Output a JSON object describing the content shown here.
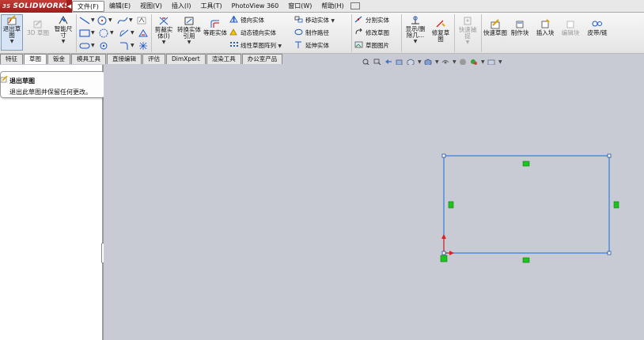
{
  "app": {
    "logo_text": "SOLIDWORKS",
    "logo_prefix": "3S"
  },
  "menu": [
    {
      "label": "文件(F)",
      "active": true
    },
    {
      "label": "编辑(E)"
    },
    {
      "label": "视图(V)"
    },
    {
      "label": "插入(I)"
    },
    {
      "label": "工具(T)"
    },
    {
      "label": "PhotoView 360"
    },
    {
      "label": "窗口(W)"
    },
    {
      "label": "帮助(H)"
    }
  ],
  "ribbon": {
    "exit_sketch": "退出草图",
    "sketch_3d": "3D 草图",
    "smart_dimension": "智能尺寸",
    "trim_entities": "剪裁实体(I)",
    "convert_entities": "转换实体引用",
    "offset_entities": "等距实体",
    "mirror_entities": "镜向实体",
    "dynamic_mirror": "动态镜向实体",
    "linear_pattern": "线性草图阵列",
    "move_entities": "移动实体",
    "make_path": "制作路径",
    "extend_entities": "延伸实体",
    "split_entities": "分割实体",
    "modify_sketch": "修改草图",
    "sketch_picture": "草图图片",
    "display_delete_relations": "显示/删除几...",
    "repair_sketch": "修复草图",
    "quick_snaps": "快速捕捉",
    "quick_sketch": "快速草图",
    "make_block": "制作块",
    "insert_block": "插入块",
    "edit_block": "编辑块",
    "belt_chain": "皮带/链"
  },
  "tabs": [
    "特征",
    "草图",
    "钣金",
    "模具工具",
    "直接编辑",
    "评估",
    "DimXpert",
    "渲染工具",
    "办公室产品"
  ],
  "active_tab": "草图",
  "tooltip": {
    "title": "退出草图",
    "description": "退出此草图并保留任何更改。"
  },
  "colors": {
    "canvas_bg": "#c8cbd4",
    "sketch_line": "#2f7de0",
    "relation_marker": "#1ec41e",
    "origin_red": "#e02020"
  }
}
